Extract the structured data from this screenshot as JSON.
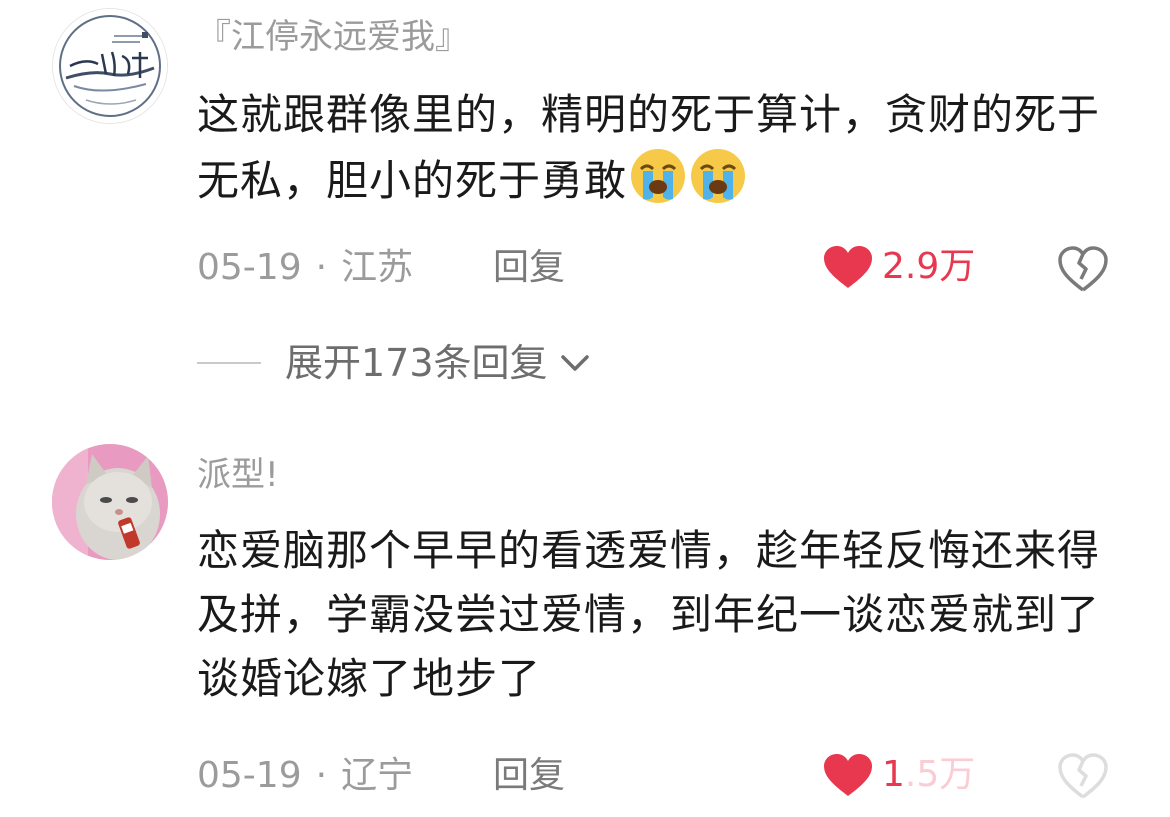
{
  "comments": [
    {
      "username": "『江停永远爱我』",
      "text": "这就跟群像里的，精明的死于算计，贪财的死于无私，胆小的死于勇敢",
      "date": "05-19",
      "location": "江苏",
      "reply_label": "回复",
      "like_count": "2.9万",
      "expand_replies_label": "展开173条回复",
      "avatar_icon": "calligraphy-logo-avatar",
      "emoji_icons": [
        "loudly-crying-face-icon",
        "loudly-crying-face-icon"
      ]
    },
    {
      "username": "派型!",
      "text": "恋爱脑那个早早的看透爱情，趁年轻反悔还来得及拼，学霸没尝过爱情，到年纪一谈恋爱就到了谈婚论嫁了地步了",
      "date": "05-19",
      "location": "辽宁",
      "reply_label": "回复",
      "like_count": "1.5万",
      "avatar_icon": "cat-photo-avatar"
    }
  ],
  "separator": "·",
  "colors": {
    "like_red": "#e8384f",
    "meta_gray": "#9b9b9b",
    "text": "#1a1a1a"
  }
}
